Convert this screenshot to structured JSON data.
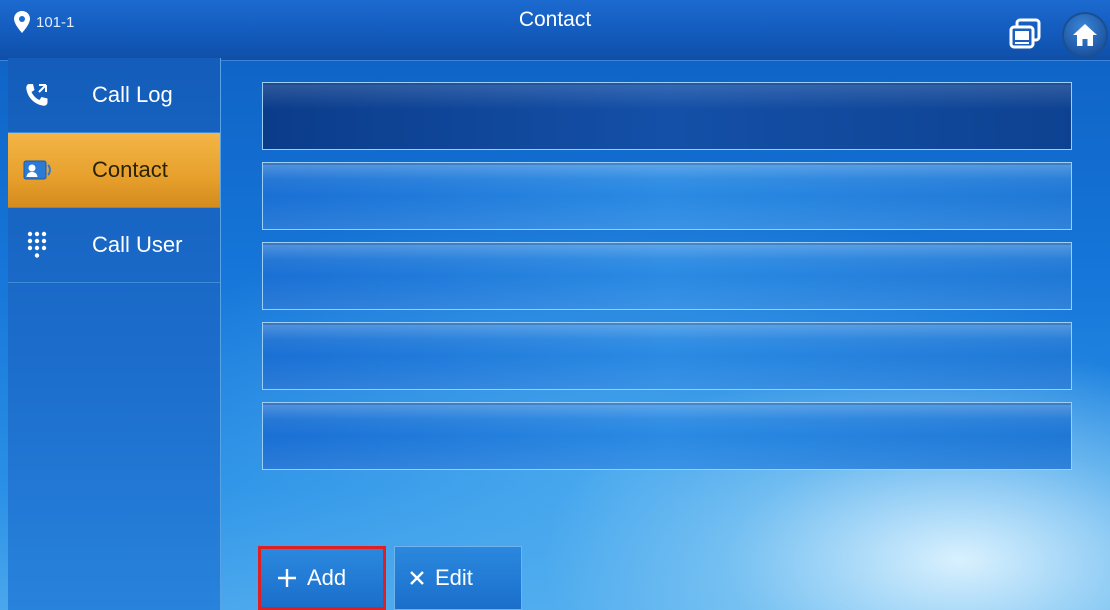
{
  "header": {
    "location": "101-1",
    "title": "Contact"
  },
  "sidebar": {
    "items": [
      {
        "label": "Call Log",
        "icon": "phone-icon",
        "active": false
      },
      {
        "label": "Contact",
        "icon": "contact-card-icon",
        "active": true
      },
      {
        "label": "Call User",
        "icon": "dialpad-icon",
        "active": false
      }
    ]
  },
  "contacts": {
    "rows": [
      "",
      "",
      "",
      "",
      ""
    ]
  },
  "actions": {
    "add_label": "Add",
    "edit_label": "Edit"
  },
  "colors": {
    "accent": "#e7a02c",
    "highlight_border": "#e02020",
    "background": "#1676d9"
  }
}
